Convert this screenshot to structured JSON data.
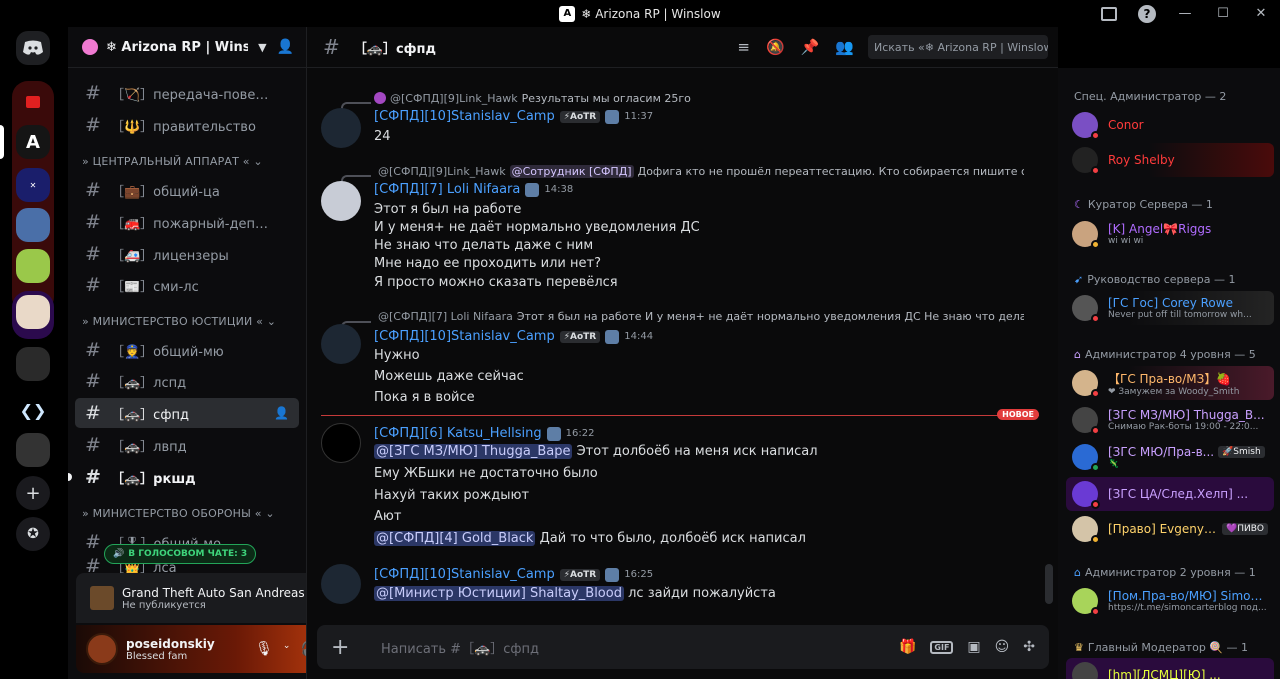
{
  "window": {
    "title": "❄ Arizona RP | Winslow"
  },
  "guild": {
    "name": "❄ Arizona RP | Winsl..."
  },
  "channels": [
    {
      "label": "［🏹］передача-повесток..."
    },
    {
      "label": "［🔱］правительство"
    },
    {
      "label": "［💼］общий-ца"
    },
    {
      "label": "［🚒］пожарный-департа..."
    },
    {
      "label": "［🚑］лицензеры"
    },
    {
      "label": "［📰］сми-лс"
    },
    {
      "label": "［👮］общий-мю"
    },
    {
      "label": "［🚓］лспд"
    },
    {
      "label": "［🚓］сфпд"
    },
    {
      "label": "［🚓］лвпд"
    },
    {
      "label": "［🚓］ркшд"
    },
    {
      "label": "［🎖］общий-мо"
    },
    {
      "label": "［👑］лса"
    }
  ],
  "categories": [
    {
      "label": "» ЦЕНТРАЛЬНЫЙ АППАРАТ « ⌄"
    },
    {
      "label": "» МИНИСТЕРСТВО ЮСТИЦИИ « ⌄"
    },
    {
      "label": "» МИНИСТЕРСТВО ОБОРОНЫ « ⌄"
    }
  ],
  "voice_pill": {
    "label": "В ГОЛОСОВОМ ЧАТЕ: 3"
  },
  "activity": {
    "game": "Grand Theft Auto San Andreas",
    "status": "Не публикуется"
  },
  "user": {
    "name": "poseidonskiy",
    "status": "Blessed fam"
  },
  "channel_header": {
    "name": "［🚓］сфпд",
    "search_placeholder": "Искать «❄ Arizona RP | Winslow»"
  },
  "messages": [
    {
      "reply_name": "@[СФПД][9]Link_Hawk",
      "reply_text": "Результаты мы огласим 25го",
      "author": "[СФПД][10]Stanislav_Camp",
      "tag": "⚡AoTR",
      "time": "11:37",
      "lines": [
        "24"
      ]
    },
    {
      "reply_name": "@[СФПД][9]Link_Hawk",
      "reply_mention": "@Сотрудник [СФПД]",
      "reply_text": "Дофига кто не прошёл переаттестацию. Кто собирается пишите сегодня и...",
      "author": "[СФПД][7] Loli Nifaara",
      "time": "14:38",
      "lines": [
        "Этот я был на работе",
        "И у меня+ не даёт нормально уведомления ДС",
        "Не знаю что делать даже с ним",
        "Мне надо ее проходить или нет?",
        "Я просто можно сказать перевёлся"
      ]
    },
    {
      "reply_name": "@[СФПД][7] Loli Nifaara",
      "reply_text": "Этот я был на работе  И у меня+ не даёт нормально уведомления ДС  Не знаю что делать даже с...",
      "author": "[СФПД][10]Stanislav_Camp",
      "tag": "⚡AoTR",
      "time": "14:44",
      "lines": [
        "Нужно",
        "Можешь даже сейчас",
        "Пока я в войсе"
      ]
    },
    {
      "author": "[СФПД][6] Katsu_Hellsing",
      "time": "16:22",
      "line1_mention": "@[ЗГС МЗ/МЮ] Thugga_Bape",
      "line1_text": "Этот долбоёб на меня иск написал",
      "lines": [
        "Ему ЖБшки не достаточно было",
        "Нахуй таких рождыют",
        "Ают"
      ],
      "last_mention": "@[СФПД][4] Gold_Black",
      "last_text": "Дай то что было, долбоёб иск написал"
    },
    {
      "author": "[СФПД][10]Stanislav_Camp",
      "tag": "⚡AoTR",
      "time": "16:25",
      "line1_mention": "@[Министр Юстиции] Shaltay_Blood",
      "line1_text": "лс зайди пожалуйста"
    }
  ],
  "new_divider": {
    "label": "НОВОЕ"
  },
  "composer": {
    "placeholder": "Написать #［🚓］сфпд"
  },
  "member_groups": [
    {
      "label": "Спец. Администратор — 2"
    },
    {
      "label": "Куратор Сервера — 1"
    },
    {
      "label": "Руководство сервера — 1"
    },
    {
      "label": "Администратор 4 уровня — 5"
    },
    {
      "label": "Администратор 2 уровня — 1"
    },
    {
      "label": "Главный Модератор 🍭 — 1"
    }
  ],
  "members": [
    {
      "name": "Conor",
      "sub": "",
      "color": "#ff3b3b"
    },
    {
      "name": "Roy Shelby",
      "sub": "",
      "color": "#ff3b3b"
    },
    {
      "name": "[K] Angel🎀Riggs",
      "sub": "wi wi wi",
      "color": "#b06cff"
    },
    {
      "name": "[ГС Гос] Corey Rowe",
      "sub": "Never put off till tomorrow wh...",
      "color": "#4ba0ff"
    },
    {
      "name": "【ГС Пра-во/МЗ】🍓",
      "sub": "❤ Замужем за Woody_Smith",
      "color": "#ffb86b"
    },
    {
      "name": "[ЗГС МЗ/МЮ] Thugga_B...",
      "sub": "Снимаю Рак-боты 19:00 - 22:0...",
      "color": "#c9a0ff"
    },
    {
      "name": "[ЗГС МЮ/Пра-в...",
      "sub": "🦎",
      "color": "#c9a0ff",
      "badge": "🚀Smish"
    },
    {
      "name": "[ЗГС ЦА/След.Хелп] ...",
      "sub": "",
      "color": "#c9a0ff"
    },
    {
      "name": "[Право] Evgeny_...",
      "sub": "",
      "color": "#ffd36b",
      "badge": "💜ПИВО"
    },
    {
      "name": "[Пом.Пра-во/МЮ] Simon...",
      "sub": "https://t.me/simoncarterblog под...",
      "color": "#4ba0ff"
    },
    {
      "name": "[hm][ЛСМЦ][Ю] ...",
      "sub": "",
      "color": "#e6ff3b"
    }
  ]
}
